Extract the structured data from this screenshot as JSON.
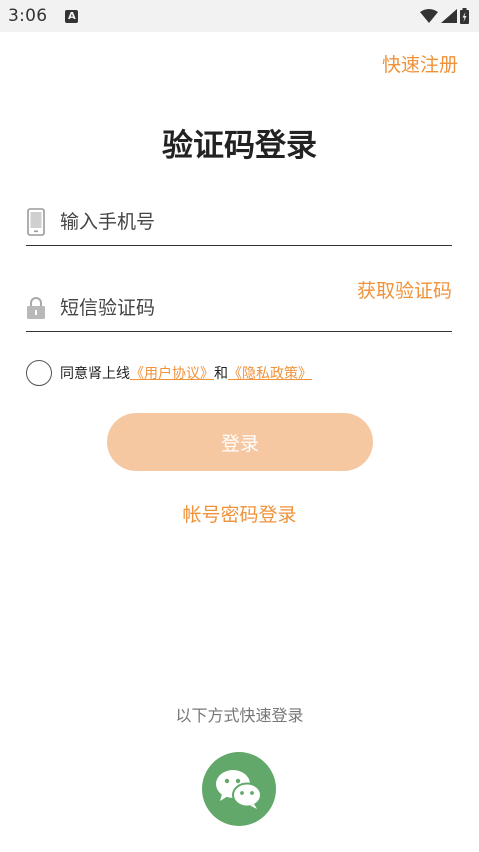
{
  "status_bar": {
    "time": "3:06",
    "notification_icon": "A"
  },
  "header": {
    "register_label": "快速注册",
    "title": "验证码登录"
  },
  "form": {
    "phone_placeholder": "输入手机号",
    "code_placeholder": "短信验证码",
    "get_code_label": "获取验证码"
  },
  "agreement": {
    "prefix": "同意肾上线",
    "user_agreement": "《用户协议》",
    "conjunction": "和",
    "privacy_policy": "《隐私政策》"
  },
  "actions": {
    "login_label": "登录",
    "password_login_label": "帐号密码登录"
  },
  "quick_login": {
    "label": "以下方式快速登录",
    "wechat_icon": "wechat-icon"
  },
  "colors": {
    "accent": "#f0923a",
    "button_bg": "#f6c8a2",
    "wechat": "#62a86a"
  }
}
